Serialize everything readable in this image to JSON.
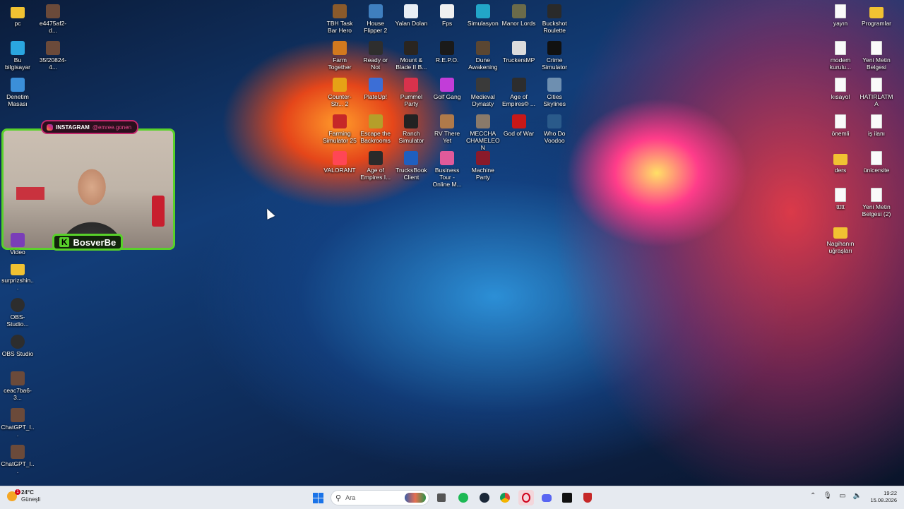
{
  "desktop": {
    "left_icons": [
      {
        "label": "pc",
        "icon": "folder-icon"
      },
      {
        "label": "e4475af2-d...",
        "icon": "image-icon"
      },
      {
        "label": "Bu bilgisayar",
        "icon": "computer-icon"
      },
      {
        "label": "35f20824-4...",
        "icon": "image-icon"
      },
      {
        "label": "Denetim Masası",
        "icon": "control-panel-icon"
      },
      {
        "label": "Video",
        "icon": "video-icon"
      },
      {
        "label": "surprizshin...",
        "icon": "folder-icon"
      },
      {
        "label": "OBS-Studio...",
        "icon": "obs-icon"
      },
      {
        "label": "OBS Studio",
        "icon": "obs-icon"
      },
      {
        "label": "ceac7ba6-3...",
        "icon": "image-icon"
      },
      {
        "label": "ChatGPT_I...",
        "icon": "image-icon"
      },
      {
        "label": "ChatGPT_I...",
        "icon": "image-icon"
      }
    ],
    "game_icons": [
      {
        "label": "TBH Task Bar Hero",
        "icon": "game-icon",
        "color": "#8a5a2b"
      },
      {
        "label": "House Flipper 2",
        "icon": "game-icon",
        "color": "#3f7fbf"
      },
      {
        "label": "Yalan Dolan",
        "icon": "document-icon",
        "color": "#e8eef5"
      },
      {
        "label": "Fps",
        "icon": "document-icon",
        "color": "#f0f0f0"
      },
      {
        "label": "Simulasyon",
        "icon": "app-icon",
        "color": "#22a6c8"
      },
      {
        "label": "Manor Lords",
        "icon": "game-icon",
        "color": "#6b6b4a"
      },
      {
        "label": "Buckshot Roulette",
        "icon": "game-icon",
        "color": "#2a2a2a"
      },
      {
        "label": "Farm Together",
        "icon": "game-icon",
        "color": "#d2791e"
      },
      {
        "label": "Ready or Not",
        "icon": "game-icon",
        "color": "#2e2e2e"
      },
      {
        "label": "Mount & Blade II B...",
        "icon": "game-icon",
        "color": "#2a2520"
      },
      {
        "label": "R.E.P.O.",
        "icon": "game-icon",
        "color": "#1a1a1a"
      },
      {
        "label": "Dune Awakening",
        "icon": "game-icon",
        "color": "#5a4632"
      },
      {
        "label": "TruckersMP",
        "icon": "game-icon",
        "color": "#dcdcdc"
      },
      {
        "label": "Crime Simulator",
        "icon": "game-icon",
        "color": "#111111"
      },
      {
        "label": "Counter-Str... 2",
        "icon": "game-icon",
        "color": "#e6a216"
      },
      {
        "label": "PlateUp!",
        "icon": "game-icon",
        "color": "#3c6ed6"
      },
      {
        "label": "Pummel Party",
        "icon": "game-icon",
        "color": "#d8324c"
      },
      {
        "label": "Golf Gang",
        "icon": "game-icon",
        "color": "#c23dd8"
      },
      {
        "label": "Medieval Dynasty",
        "icon": "game-icon",
        "color": "#3a3a3a"
      },
      {
        "label": "Age of Empires® ...",
        "icon": "game-icon",
        "color": "#2d2d2d"
      },
      {
        "label": "Cities Skylines",
        "icon": "game-icon",
        "color": "#6e8fb0"
      },
      {
        "label": "Farming Simulator 25",
        "icon": "game-icon",
        "color": "#c62828"
      },
      {
        "label": "Escape the Backrooms",
        "icon": "game-icon",
        "color": "#b59f2a"
      },
      {
        "label": "Ranch Simulator",
        "icon": "game-icon",
        "color": "#222222"
      },
      {
        "label": "RV There Yet",
        "icon": "game-icon",
        "color": "#b07a4a"
      },
      {
        "label": "MECCHA CHAMELEON",
        "icon": "game-icon",
        "color": "#8a7a6a"
      },
      {
        "label": "God of War",
        "icon": "game-icon",
        "color": "#c81818"
      },
      {
        "label": "Who Do Voodoo",
        "icon": "game-icon",
        "color": "#2a5a8a"
      },
      {
        "label": "VALORANT",
        "icon": "game-icon",
        "color": "#ff4655"
      },
      {
        "label": "Age of Empires I...",
        "icon": "game-icon",
        "color": "#2a2a2a"
      },
      {
        "label": "TrucksBook Client",
        "icon": "game-icon",
        "color": "#1f5fbf"
      },
      {
        "label": "Business Tour - Online M...",
        "icon": "game-icon",
        "color": "#e05a9a"
      },
      {
        "label": "Machine Party",
        "icon": "game-icon",
        "color": "#8a1a2a"
      }
    ],
    "right_icons": [
      {
        "label": "yayın",
        "icon": "document-icon"
      },
      {
        "label": "Programlar",
        "icon": "folder-icon"
      },
      {
        "label": "modem kurulu...",
        "icon": "document-icon"
      },
      {
        "label": "Yeni Metin Belgesi",
        "icon": "document-icon"
      },
      {
        "label": "kısayol",
        "icon": "document-icon"
      },
      {
        "label": "HATIRLATMA",
        "icon": "document-icon"
      },
      {
        "label": "önemli",
        "icon": "document-icon"
      },
      {
        "label": "iş ilanı",
        "icon": "document-icon"
      },
      {
        "label": "ders",
        "icon": "folder-icon"
      },
      {
        "label": "ünicersite",
        "icon": "document-icon"
      },
      {
        "label": "ttttt",
        "icon": "document-icon"
      },
      {
        "label": "Yeni Metin Belgesi (2)",
        "icon": "document-icon"
      },
      {
        "label": "Nagihanın uğraşları",
        "icon": "folder-icon"
      }
    ]
  },
  "overlay": {
    "instagram_label": "INSTAGRAM",
    "instagram_handle": "@emree.gonen",
    "nameplate_letter": "K",
    "nameplate_name": "BosverBe"
  },
  "taskbar": {
    "weather_temp": "24°C",
    "weather_condition": "Güneşli",
    "weather_badge": "1",
    "search_placeholder": "Ara",
    "apps": [
      "file-explorer-icon",
      "spotify-icon",
      "steam-icon",
      "chrome-icon",
      "opera-gx-icon",
      "discord-icon",
      "game-launcher-icon",
      "shield-icon"
    ],
    "tray_icons": [
      "chevron-up-icon",
      "microphone-icon",
      "network-icon",
      "volume-icon"
    ],
    "time": "19:22",
    "date": "15.08.2026"
  }
}
